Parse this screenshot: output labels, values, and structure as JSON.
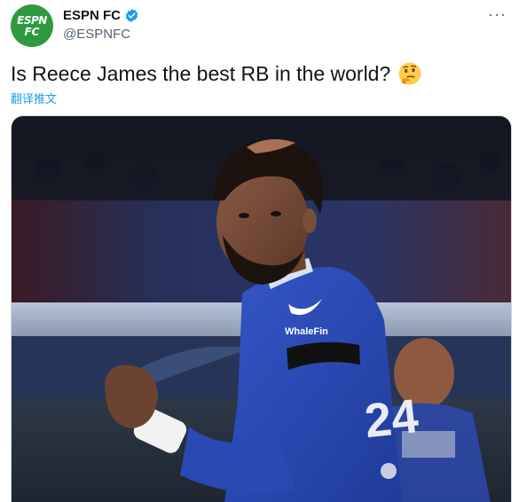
{
  "tweet": {
    "avatar": {
      "line1": "ESPN",
      "line2": "FC"
    },
    "display_name": "ESPN FC",
    "handle": "@ESPNFC",
    "more_label": "···",
    "text": "Is Reece James the best RB in the world?",
    "emoji_icon": "thinking-face-icon",
    "translate_label": "翻译推文",
    "media": {
      "jersey_sponsor": "WhaleFin",
      "jersey_number": "24"
    }
  },
  "colors": {
    "verified_blue": "#1d9bf0",
    "avatar_green": "#2e9a3e",
    "jersey_blue": "#2b4bb3",
    "link_blue": "#1d9bf0"
  }
}
